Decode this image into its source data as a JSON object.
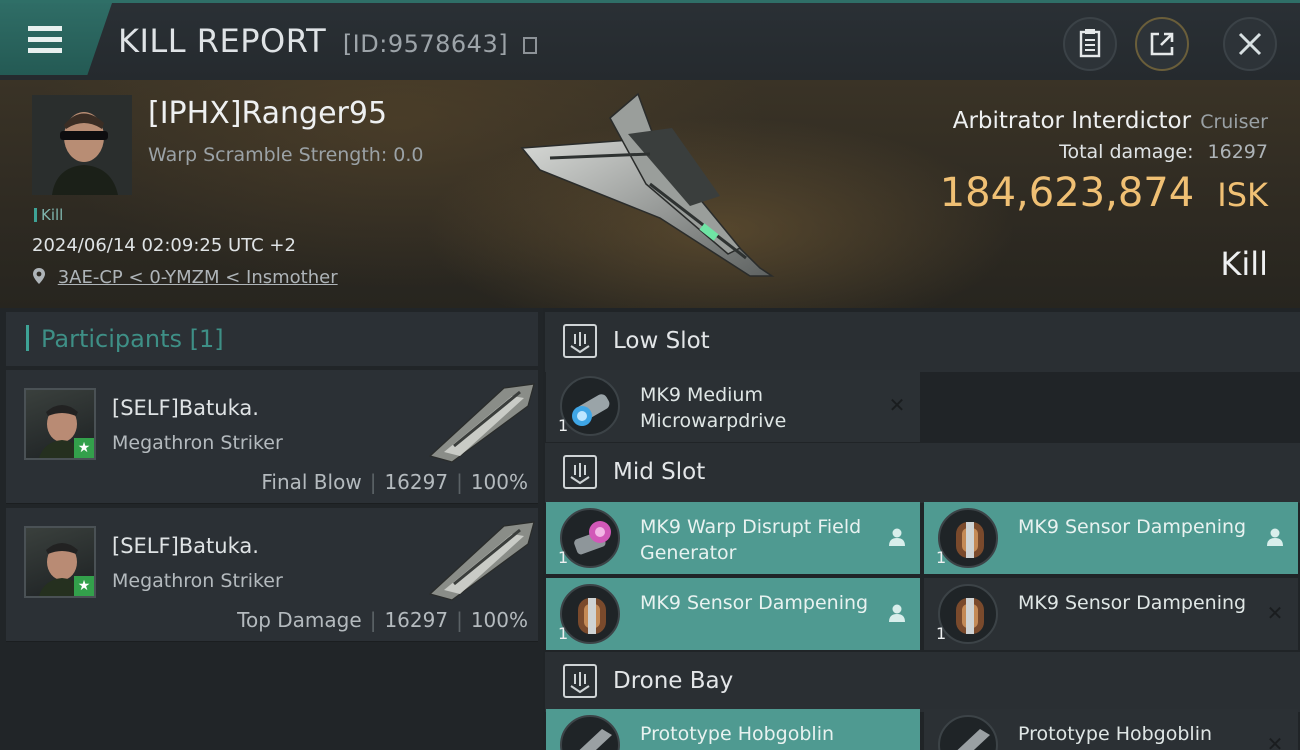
{
  "header": {
    "title": "KILL REPORT",
    "report_id": "[ID:9578643]"
  },
  "victim": {
    "name": "[IPHX]Ranger95",
    "warp_scramble": "Warp Scramble Strength: 0.0",
    "tag": "Kill",
    "datetime": "2024/06/14 02:09:25 UTC +2",
    "location": "3AE-CP < 0-YMZM < Insmother"
  },
  "ship": {
    "name": "Arbitrator Interdictor",
    "class": "Cruiser",
    "damage_label": "Total damage:",
    "damage_value": "16297",
    "isk_value": "184,623,874",
    "isk_unit": "ISK",
    "result": "Kill"
  },
  "participants": {
    "title": "Participants [1]",
    "items": [
      {
        "name": "[SELF]Batuka.",
        "ship": "Megathron Striker",
        "role": "Final Blow",
        "damage": "16297",
        "percent": "100%"
      },
      {
        "name": "[SELF]Batuka.",
        "ship": "Megathron Striker",
        "role": "Top Damage",
        "damage": "16297",
        "percent": "100%"
      }
    ]
  },
  "fitting": {
    "low_slot": {
      "title": "Low Slot",
      "modules": [
        {
          "name": "MK9 Medium Microwarpdrive",
          "qty": "1",
          "status": "destroyed",
          "icon": "microwarpdrive-icon"
        }
      ]
    },
    "mid_slot": {
      "title": "Mid Slot",
      "modules": [
        {
          "name": "MK9 Warp Disrupt Field Generator",
          "qty": "1",
          "status": "dropped",
          "icon": "warp-disruptor-icon"
        },
        {
          "name": "MK9 Sensor Dampening",
          "qty": "1",
          "status": "dropped",
          "icon": "sensor-dampener-icon"
        },
        {
          "name": "MK9 Sensor Dampening",
          "qty": "1",
          "status": "dropped",
          "icon": "sensor-dampener-icon"
        },
        {
          "name": "MK9 Sensor Dampening",
          "qty": "1",
          "status": "destroyed",
          "icon": "sensor-dampener-icon"
        }
      ]
    },
    "drone_bay": {
      "title": "Drone Bay",
      "modules": [
        {
          "name": "Prototype Hobgoblin",
          "status": "dropped",
          "icon": "drone-icon"
        },
        {
          "name": "Prototype Hobgoblin",
          "status": "destroyed",
          "icon": "drone-icon"
        }
      ]
    }
  },
  "colors": {
    "accent": "#3ea396",
    "isk": "#f0c074",
    "dropped_bg": "#4f9a91"
  }
}
